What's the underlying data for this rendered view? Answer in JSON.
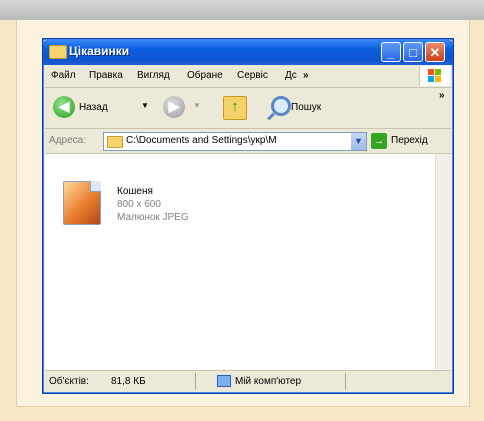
{
  "window": {
    "title": "Цікавинки",
    "minimize_glyph": "_",
    "maximize_glyph": "□",
    "close_glyph": "✕"
  },
  "menu": {
    "items": [
      "Файл",
      "Правка",
      "Вигляд",
      "Обране",
      "Сервіс",
      "Дс"
    ],
    "overflow": "»"
  },
  "toolbar": {
    "back_label": "Назад",
    "search_label": "Пошук",
    "overflow": "»"
  },
  "address": {
    "label": "Адреса:",
    "value": "C:\\Documents and Settings\\укр\\М",
    "go_label": "Перехід"
  },
  "files": [
    {
      "name": "Кошеня",
      "dimensions": "800 x 600",
      "type": "Малюнок JPEG"
    }
  ],
  "status": {
    "objects_label": "Об'єктів:",
    "size": "81,8 КБ",
    "location": "Мій комп'ютер"
  },
  "colors": {
    "titlebar": "#0a5ee0",
    "page_background": "#f5e6c4",
    "panel_background": "#fbf3df"
  }
}
